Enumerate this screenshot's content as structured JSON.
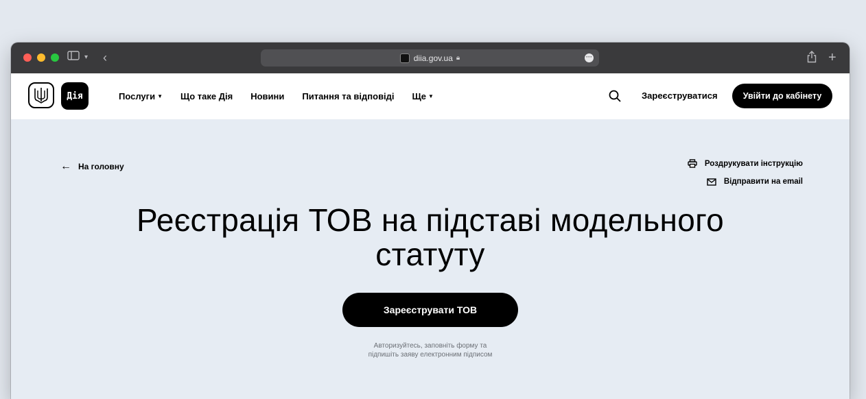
{
  "browser": {
    "url": "diia.gov.ua"
  },
  "nav": {
    "logo_text": "Дія",
    "links": [
      {
        "label": "Послуги",
        "caret": true
      },
      {
        "label": "Що таке Дія",
        "caret": false
      },
      {
        "label": "Новини",
        "caret": false
      },
      {
        "label": "Питання та відповіді",
        "caret": false
      },
      {
        "label": "Ще",
        "caret": true
      }
    ],
    "register_label": "Зареєструватися",
    "login_label": "Увійти до кабінету"
  },
  "content": {
    "back_label": "На головну",
    "print_label": "Роздрукувати інструкцію",
    "email_label": "Відправити на email",
    "title_line1": "Реєстрація ТОВ на підставі модельного",
    "title_line2": "статуту",
    "cta_label": "Зареєструвати ТОВ",
    "hint_line1": "Авторизуйтесь, заповніть форму та",
    "hint_line2": "підпишіть заяву електронним підписом"
  },
  "colors": {
    "page_bg": "#e6ecf3",
    "primary": "#000000",
    "on_primary": "#ffffff",
    "titlebar": "#3a3a3c"
  },
  "icons": [
    "sidebar-icon",
    "chevron-down-icon",
    "back-icon",
    "lock-icon",
    "more-icon",
    "share-icon",
    "plus-icon",
    "trident-icon",
    "search-icon",
    "arrow-left-icon",
    "printer-icon",
    "mail-icon"
  ]
}
